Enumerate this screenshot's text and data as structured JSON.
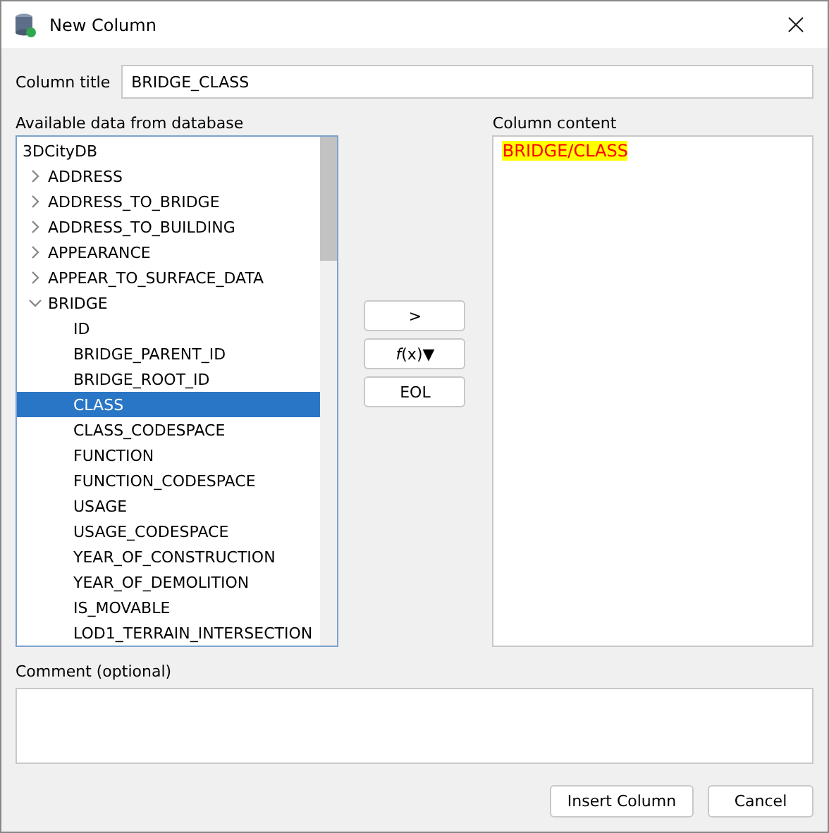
{
  "window": {
    "title": "New Column"
  },
  "column_title": {
    "label": "Column title",
    "value": "BRIDGE_CLASS"
  },
  "available": {
    "label": "Available data from database",
    "tree": [
      {
        "label": "3DCityDB",
        "selected": false,
        "children": [
          {
            "label": "ADDRESS",
            "expanded": false,
            "selected": false
          },
          {
            "label": "ADDRESS_TO_BRIDGE",
            "expanded": false,
            "selected": false
          },
          {
            "label": "ADDRESS_TO_BUILDING",
            "expanded": false,
            "selected": false
          },
          {
            "label": "APPEARANCE",
            "expanded": false,
            "selected": false
          },
          {
            "label": "APPEAR_TO_SURFACE_DATA",
            "expanded": false,
            "selected": false
          },
          {
            "label": "BRIDGE",
            "expanded": true,
            "selected": false,
            "children": [
              {
                "label": "ID",
                "selected": false
              },
              {
                "label": "BRIDGE_PARENT_ID",
                "selected": false
              },
              {
                "label": "BRIDGE_ROOT_ID",
                "selected": false
              },
              {
                "label": "CLASS",
                "selected": true
              },
              {
                "label": "CLASS_CODESPACE",
                "selected": false
              },
              {
                "label": "FUNCTION",
                "selected": false
              },
              {
                "label": "FUNCTION_CODESPACE",
                "selected": false
              },
              {
                "label": "USAGE",
                "selected": false
              },
              {
                "label": "USAGE_CODESPACE",
                "selected": false
              },
              {
                "label": "YEAR_OF_CONSTRUCTION",
                "selected": false
              },
              {
                "label": "YEAR_OF_DEMOLITION",
                "selected": false
              },
              {
                "label": "IS_MOVABLE",
                "selected": false
              },
              {
                "label": "LOD1_TERRAIN_INTERSECTION",
                "selected": false
              }
            ]
          }
        ]
      }
    ]
  },
  "middle_buttons": [
    {
      "label": ">"
    },
    {
      "label": "*f*(x)▼"
    },
    {
      "label": "EOL"
    }
  ],
  "column_content": {
    "label": "Column content",
    "tokens": [
      {
        "text": "BRIDGE/CLASS",
        "kind": "field"
      }
    ]
  },
  "comment": {
    "label": "Comment (optional)"
  },
  "buttons": [
    {
      "label": "Insert Column"
    },
    {
      "label": "Cancel"
    }
  ]
}
